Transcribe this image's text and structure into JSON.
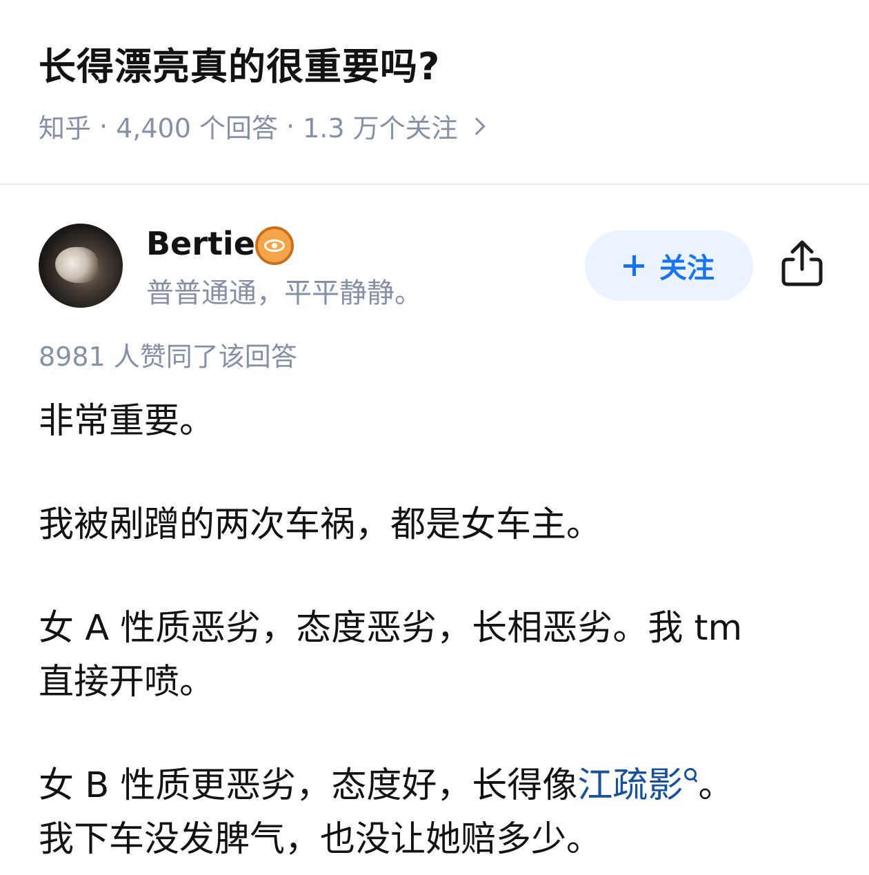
{
  "question": {
    "title": "长得漂亮真的很重要吗?",
    "site": "知乎",
    "answers_count": "4,400 个回答",
    "followers_count": "1.3 万个关注"
  },
  "author": {
    "name": "Bertie",
    "bio": "普普通通，平平静静。",
    "badge_icon": "eye-icon",
    "follow_label": "关注",
    "accent_color": "#1772f6"
  },
  "answer": {
    "upvotes": "8981 人赞同了该回答",
    "p1": "非常重要。",
    "p2": "我被剐蹭的两次车祸，都是女车主。",
    "p3a": "女 A 性质恶劣，态度恶劣，长相恶劣。我 tm",
    "p3b": "直接开喷。",
    "p4_before": "女 B 性质更恶劣，态度好，长得像",
    "p4_link": "江疏影",
    "p4_after": "。",
    "p4b": "我下车没发脾气，也没让她赔多少。"
  }
}
